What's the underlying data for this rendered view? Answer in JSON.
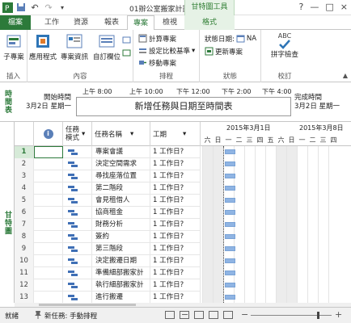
{
  "window": {
    "title": "01辦公室搬家計劃 - ...",
    "context_tool": "甘特圖工具",
    "buttons": [
      "?",
      "—",
      "□",
      "×"
    ]
  },
  "tabs": [
    {
      "label": "檔案"
    },
    {
      "label": "工作"
    },
    {
      "label": "資源"
    },
    {
      "label": "報表"
    },
    {
      "label": "專案"
    },
    {
      "label": "檢視"
    },
    {
      "label": "格式"
    }
  ],
  "ribbon": {
    "groups": [
      {
        "label": "插入",
        "buttons": [
          {
            "label": "子專案"
          }
        ]
      },
      {
        "label": "內容",
        "buttons": [
          {
            "label": "應用程式"
          },
          {
            "label": "專案資訊"
          },
          {
            "label": "自訂欄位"
          }
        ]
      },
      {
        "label": "排程",
        "buttons": [
          {
            "label": "計算專案"
          },
          {
            "label": "設定比較基準"
          },
          {
            "label": "移動專案"
          }
        ]
      },
      {
        "label": "狀態",
        "buttons": [
          {
            "label": "狀態日期:"
          },
          {
            "label": "NA"
          },
          {
            "label": "更新專案"
          }
        ]
      },
      {
        "label": "校訂",
        "buttons": [
          {
            "label": "ABC"
          },
          {
            "label": "拼字檢查"
          }
        ]
      }
    ]
  },
  "timeline": {
    "side_label": "時間表",
    "start_label": "開始時間",
    "start_date": "3月2日 星期一",
    "finish_label": "完成時間",
    "finish_date": "3月2日 星期一",
    "ticks": [
      "上午 8:00",
      "上午 10:00",
      "下午 12:00",
      "下午 2:00",
      "下午 4:00"
    ],
    "bar_text": "新增任務與日期至時間表"
  },
  "gantt": {
    "side_label": "甘特圖",
    "headers": {
      "info": "i",
      "mode": "任務模式",
      "name": "任務名稱",
      "duration": "工期"
    },
    "rows": [
      {
        "id": "1",
        "name": "專案會議",
        "duration": "1 工作日?"
      },
      {
        "id": "2",
        "name": "決定空間需求",
        "duration": "1 工作日?"
      },
      {
        "id": "3",
        "name": "尋找座落位置",
        "duration": "1 工作日?"
      },
      {
        "id": "4",
        "name": "第二階段",
        "duration": "1 工作日?"
      },
      {
        "id": "5",
        "name": "會見租借人",
        "duration": "1 工作日?"
      },
      {
        "id": "6",
        "name": "協商租金",
        "duration": "1 工作日?"
      },
      {
        "id": "7",
        "name": "財務分析",
        "duration": "1 工作日?"
      },
      {
        "id": "8",
        "name": "簽約",
        "duration": "1 工作日?"
      },
      {
        "id": "9",
        "name": "第三階段",
        "duration": "1 工作日?"
      },
      {
        "id": "10",
        "name": "決定搬遷日期",
        "duration": "1 工作日?"
      },
      {
        "id": "11",
        "name": "準備細部搬家計",
        "duration": "1 工作日?"
      },
      {
        "id": "12",
        "name": "執行細部搬家計",
        "duration": "1 工作日?"
      },
      {
        "id": "13",
        "name": "進行搬遷",
        "duration": "1 工作日?"
      }
    ],
    "weeks": [
      "2015年3月1日",
      "2015年3月8日"
    ],
    "days": [
      "六",
      "日",
      "一",
      "二",
      "三",
      "四",
      "五",
      "六",
      "日",
      "一",
      "二",
      "三",
      "四"
    ]
  },
  "status_bar": {
    "ready": "就緒",
    "new_task": "新任務: 手動排程"
  }
}
